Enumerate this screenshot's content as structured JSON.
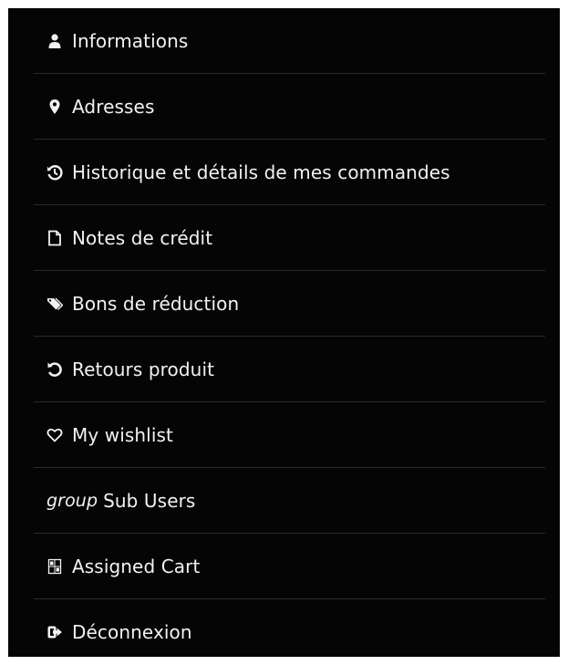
{
  "menu": {
    "items": [
      {
        "label": "Informations",
        "icon": "user-icon"
      },
      {
        "label": "Adresses",
        "icon": "map-marker-icon"
      },
      {
        "label": "Historique et détails de mes commandes",
        "icon": "history-icon"
      },
      {
        "label": "Notes de crédit",
        "icon": "file-icon"
      },
      {
        "label": "Bons de réduction",
        "icon": "tags-icon"
      },
      {
        "label": "Retours produit",
        "icon": "undo-icon"
      },
      {
        "label": "My wishlist",
        "icon": "heart-icon"
      },
      {
        "label": "Sub Users",
        "icon": "group-icon",
        "icon_text": "group"
      },
      {
        "label": "Assigned Cart",
        "icon": "cart-glyph-icon"
      },
      {
        "label": "Déconnexion",
        "icon": "sign-out-icon"
      }
    ]
  },
  "colors": {
    "background": "#050505",
    "text": "#f2f2f2",
    "divider": "#2a2a2a"
  }
}
